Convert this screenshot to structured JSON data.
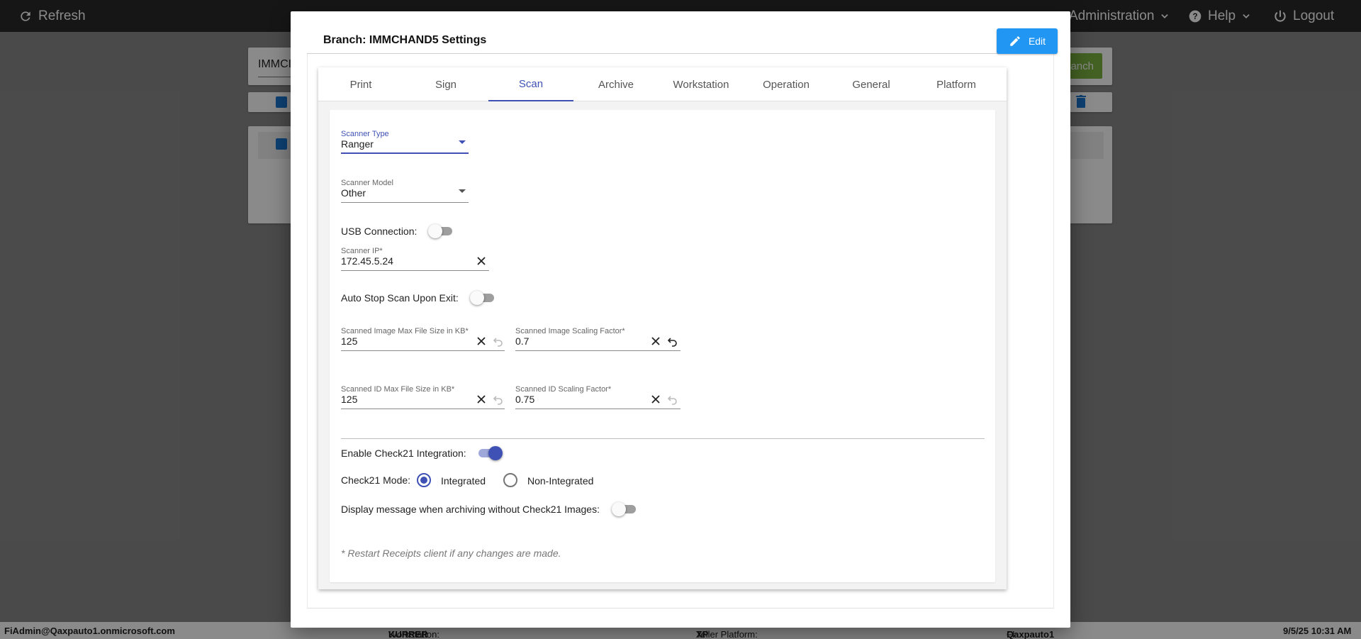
{
  "topbar": {
    "refresh_label": "Refresh",
    "administration_label": "Administration",
    "help_label": "Help",
    "logout_label": "Logout"
  },
  "background": {
    "search_value": "IMMCI",
    "green_button_label": "anch"
  },
  "statusbar": {
    "user": "FiAdmin@Qaxpauto1.onmicrosoft.com",
    "workstation_label": "Workstation:",
    "workstation_value": "KURRER",
    "platform_label": "Teller Platform:",
    "platform_value": "XP",
    "fi_label": "FI:",
    "fi_value": "Qaxpauto1",
    "datetime": "9/5/25 10:31 AM"
  },
  "modal": {
    "title": "Branch: IMMCHAND5 Settings",
    "edit_label": "Edit",
    "tabs": [
      {
        "label": "Print"
      },
      {
        "label": "Sign"
      },
      {
        "label": "Scan"
      },
      {
        "label": "Archive"
      },
      {
        "label": "Workstation"
      },
      {
        "label": "Operation"
      },
      {
        "label": "General"
      },
      {
        "label": "Platform"
      }
    ],
    "active_tab": "Scan"
  },
  "scan": {
    "scanner_type": {
      "label": "Scanner Type",
      "value": "Ranger"
    },
    "scanner_model": {
      "label": "Scanner Model",
      "value": "Other"
    },
    "usb_connection": {
      "label": "USB Connection:",
      "enabled": false
    },
    "scanner_ip": {
      "label": "Scanner IP*",
      "value": "172.45.5.24"
    },
    "auto_stop": {
      "label": "Auto Stop Scan Upon Exit:",
      "enabled": false
    },
    "image_max_size": {
      "label": "Scanned Image Max File Size in KB*",
      "value": "125"
    },
    "image_scaling": {
      "label": "Scanned Image Scaling Factor*",
      "value": "0.7"
    },
    "id_max_size": {
      "label": "Scanned ID Max File Size in KB*",
      "value": "125"
    },
    "id_scaling": {
      "label": "Scanned ID Scaling Factor*",
      "value": "0.75"
    },
    "check21_integration": {
      "label": "Enable Check21 Integration:",
      "enabled": true
    },
    "check21_mode": {
      "label": "Check21 Mode:",
      "options": [
        "Integrated",
        "Non-Integrated"
      ],
      "selected": "Integrated"
    },
    "display_message": {
      "label": "Display message when archiving without Check21 Images:",
      "enabled": false
    },
    "note": "* Restart Receipts client if any changes are made."
  },
  "colors": {
    "accent": "#3f51b5",
    "edit_button": "#2196f3",
    "green_button": "#7cb342"
  }
}
